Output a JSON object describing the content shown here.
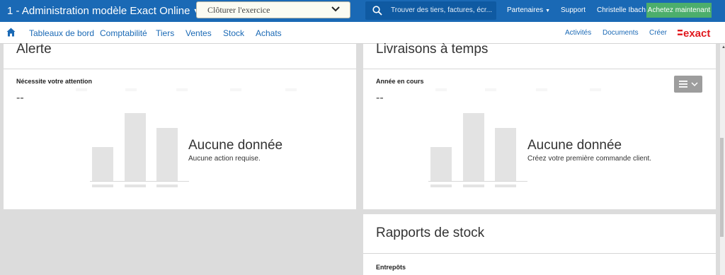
{
  "header": {
    "app_title": "1 - Administration modèle Exact Online",
    "action_select_value": "Clôturer l'exercice",
    "search_placeholder": "Trouver des tiers, factures, écr...",
    "partners_label": "Partenaires",
    "support_label": "Support",
    "user_name": "Christelle Ibach",
    "buy_button_label": "Achetez maintenant"
  },
  "nav": {
    "items": [
      "Tableaux de bord",
      "Comptabilité",
      "Tiers",
      "Ventes",
      "Stock",
      "Achats"
    ],
    "right_items": [
      "Activités",
      "Documents",
      "Créer"
    ],
    "brand_label": "exact"
  },
  "widgets": {
    "alerts": {
      "title": "Alerte",
      "subtitle": "Nécessite votre attention",
      "value": "--",
      "empty_title": "Aucune donnée",
      "empty_message": "Aucune action requise."
    },
    "deliveries": {
      "title": "Livraisons à temps",
      "subtitle": "Année en cours",
      "value": "--",
      "empty_title": "Aucune donnée",
      "empty_message": "Créez votre première commande client."
    },
    "stock_reports": {
      "title": "Rapports de stock",
      "subtitle": "Entrepôts"
    }
  },
  "colors": {
    "header_blue": "#1a69b5",
    "buy_green": "#4cae6c",
    "brand_red": "#e1191e"
  },
  "icons": {
    "search": "magnifier-icon",
    "home": "home-icon",
    "menu": "hamburger-icon"
  }
}
